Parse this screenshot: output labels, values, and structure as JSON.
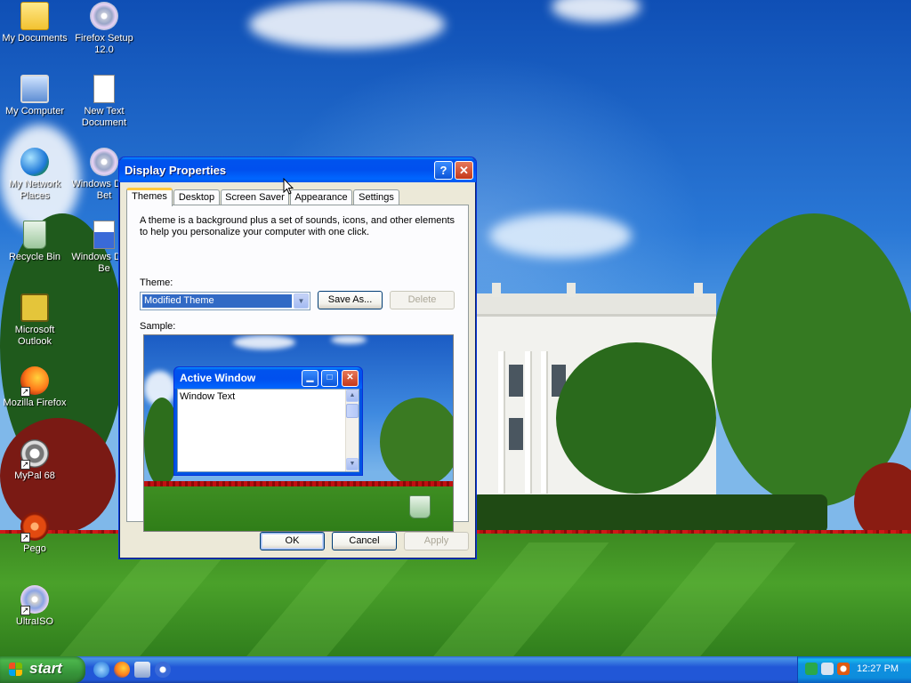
{
  "desktop": {
    "icons": [
      {
        "label": "My Documents",
        "icon": "folder-icon"
      },
      {
        "label": "Firefox Setup 12.0",
        "icon": "installer-cd-icon"
      },
      {
        "label": "My Computer",
        "icon": "computer-icon"
      },
      {
        "label": "New Text Document",
        "icon": "text-document-icon"
      },
      {
        "label": "My Network Places",
        "icon": "network-places-icon"
      },
      {
        "label": "Windows Delta Bet",
        "icon": "cd-icon"
      },
      {
        "label": "Recycle Bin",
        "icon": "recycle-bin-icon"
      },
      {
        "label": "Windows Delta Be",
        "icon": "window-app-icon"
      },
      {
        "label": "Microsoft Outlook",
        "icon": "outlook-icon"
      },
      {
        "label": "Mozilla Firefox",
        "icon": "firefox-icon"
      },
      {
        "label": "MyPal 68",
        "icon": "mypal-icon"
      },
      {
        "label": "Pego",
        "icon": "pego-icon"
      },
      {
        "label": "UltraISO",
        "icon": "ultraiso-icon"
      }
    ]
  },
  "dialog": {
    "title": "Display Properties",
    "help_glyph": "?",
    "close_glyph": "✕",
    "tabs": [
      {
        "label": "Themes",
        "active": true
      },
      {
        "label": "Desktop",
        "active": false
      },
      {
        "label": "Screen Saver",
        "active": false
      },
      {
        "label": "Appearance",
        "active": false
      },
      {
        "label": "Settings",
        "active": false
      }
    ],
    "description": "A theme is a background plus a set of sounds, icons, and other elements to help you personalize your computer with one click.",
    "theme_label": "Theme:",
    "theme_value": "Modified Theme",
    "save_as_label": "Save As...",
    "delete_label": "Delete",
    "sample_label": "Sample:",
    "sample_window": {
      "title": "Active Window",
      "body_text": "Window Text"
    },
    "ok_label": "OK",
    "cancel_label": "Cancel",
    "apply_label": "Apply"
  },
  "taskbar": {
    "start_label": "start",
    "quick_launch": [
      "internet-explorer-icon",
      "firefox-icon",
      "settings-app-icon",
      "media-player-icon"
    ],
    "tray_icons": [
      "network-icon",
      "sound-icon",
      "search-icon"
    ],
    "clock": "12:27 PM"
  },
  "colors": {
    "title_blue": "#0054e3",
    "start_green": "#37963a",
    "selection_blue": "#316ac5",
    "tab_highlight": "#ffc83c"
  }
}
